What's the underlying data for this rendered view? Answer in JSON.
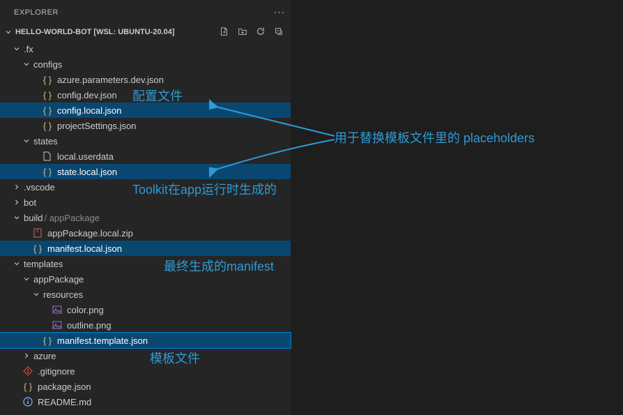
{
  "header": {
    "title": "EXPLORER"
  },
  "sectionTitle": "HELLO-WORLD-BOT [WSL: UBUNTU-20.04]",
  "tree": {
    "fx": ".fx",
    "configs": "configs",
    "azure_params": "azure.parameters.dev.json",
    "config_dev": "config.dev.json",
    "config_local": "config.local.json",
    "project_settings": "projectSettings.json",
    "states": "states",
    "local_userdata": "local.userdata",
    "state_local": "state.local.json",
    "vscode": ".vscode",
    "bot": "bot",
    "build": "build",
    "build_sub": "/ appPackage",
    "app_package_zip": "appPackage.local.zip",
    "manifest_local": "manifest.local.json",
    "templates": "templates",
    "app_package": "appPackage",
    "resources": "resources",
    "color_png": "color.png",
    "outline_png": "outline.png",
    "manifest_template": "manifest.template.json",
    "azure": "azure",
    "gitignore": ".gitignore",
    "package_json": "package.json",
    "readme": "README.md"
  },
  "annotations": {
    "config_file": "配置文件",
    "placeholders": "用于替换模板文件里的 placeholders",
    "toolkit_gen": "Toolkit在app运行时生成的",
    "final_manifest": "最终生成的manifest",
    "template_file": "模板文件"
  }
}
